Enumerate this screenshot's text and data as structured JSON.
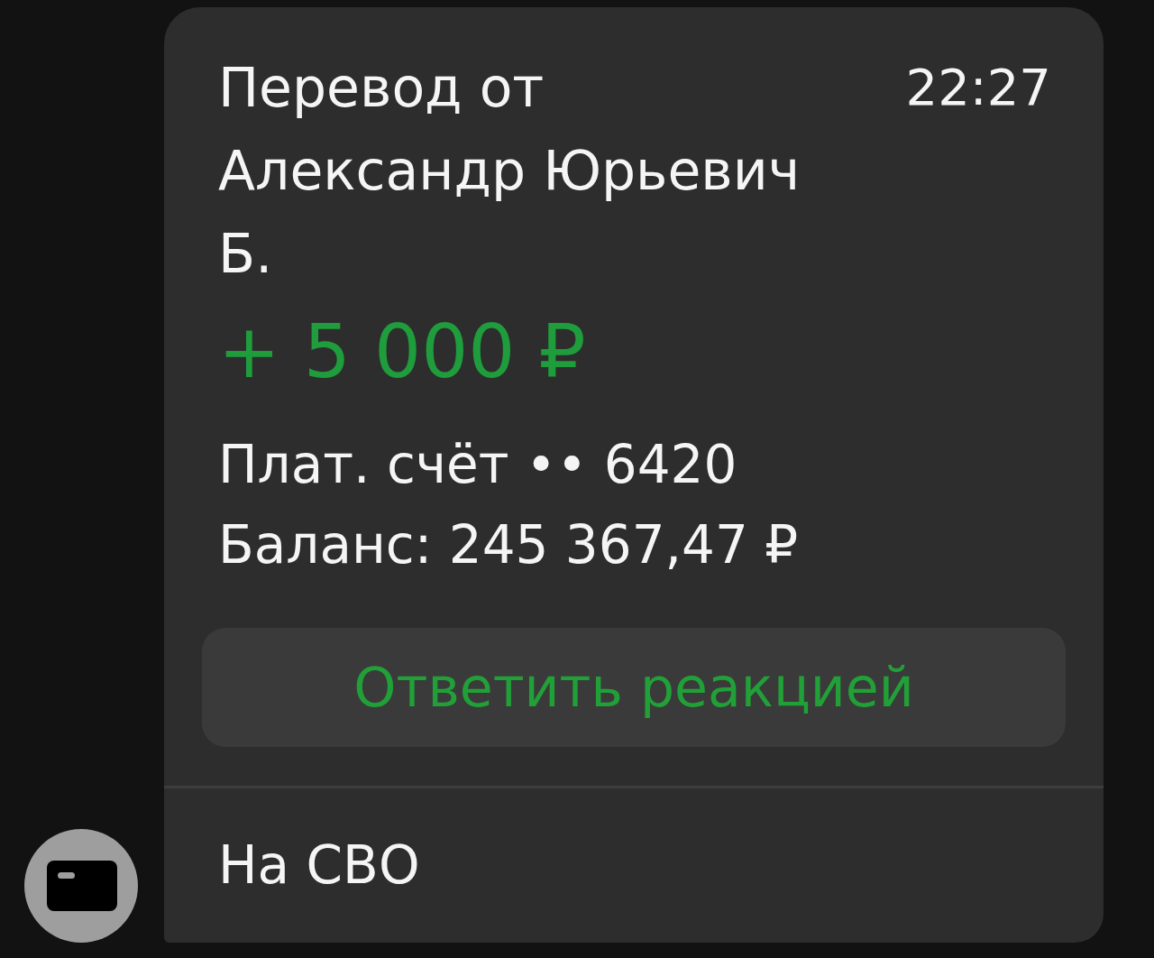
{
  "message": {
    "title": "Перевод от Александр Юрьевич Б.",
    "time": "22:27",
    "amount": "+ 5 000 ₽",
    "account": "Плат. счёт •• 6420",
    "balance": "Баланс: 245 367,47 ₽",
    "reaction_button": "Ответить реакцией",
    "comment": "На СВО"
  }
}
